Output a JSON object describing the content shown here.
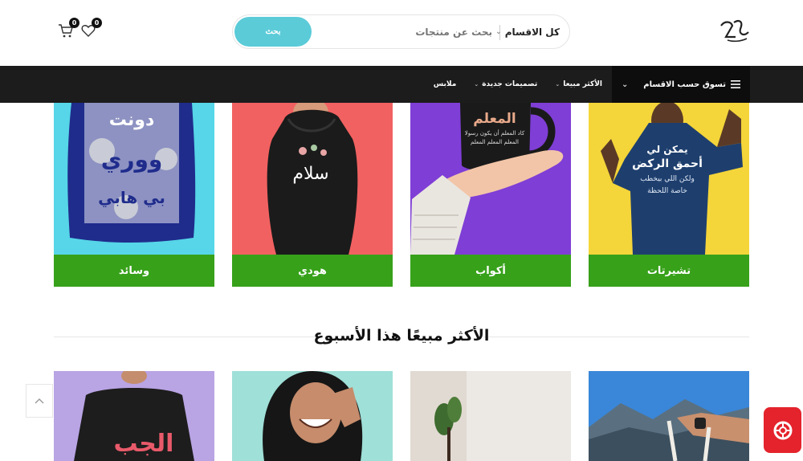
{
  "header": {
    "search": {
      "button_label": "بحث",
      "placeholder": "بحث عن منتجات",
      "category_label": "كل الاقسام"
    },
    "wishlist_count": "0",
    "cart_count": "0",
    "icons": [
      "logo",
      "wishlist-heart-icon",
      "cart-icon",
      "chevron-down-icon"
    ]
  },
  "nav": {
    "category_toggle": "تسوق حسب الاقسام",
    "items": [
      {
        "label": "الأكثر مبيعا",
        "has_dropdown": true
      },
      {
        "label": "تصميمات جديدة",
        "has_dropdown": true
      },
      {
        "label": "ملابس",
        "has_dropdown": false
      }
    ]
  },
  "categories": [
    {
      "label": "تشيرتات",
      "bg": "#f4d53a",
      "shirt_text": "يمكن لي أحمق الركض"
    },
    {
      "label": "أكواب",
      "bg": "#7f3ed6",
      "mug_text": "المعلم"
    },
    {
      "label": "هودي",
      "bg": "#f26161",
      "hoodie_text": "سلام"
    },
    {
      "label": "وسائد",
      "bg": "#56d6e8",
      "pillow_text": "دونت ووري بي هابي"
    }
  ],
  "section": {
    "title": "الأكثر مبيعًا هذا الأسبوع"
  },
  "products": [
    {
      "name": "product-tshirt-purple",
      "text": "الجب"
    },
    {
      "name": "product-hoodie-woman"
    },
    {
      "name": "product-mug-interior"
    },
    {
      "name": "product-tote-mountains"
    }
  ],
  "colors": {
    "accent": "#5bcbd8",
    "nav_bg": "#1c1c1c",
    "category_label_bg": "#37a11a",
    "help_button": "#e4232c"
  }
}
